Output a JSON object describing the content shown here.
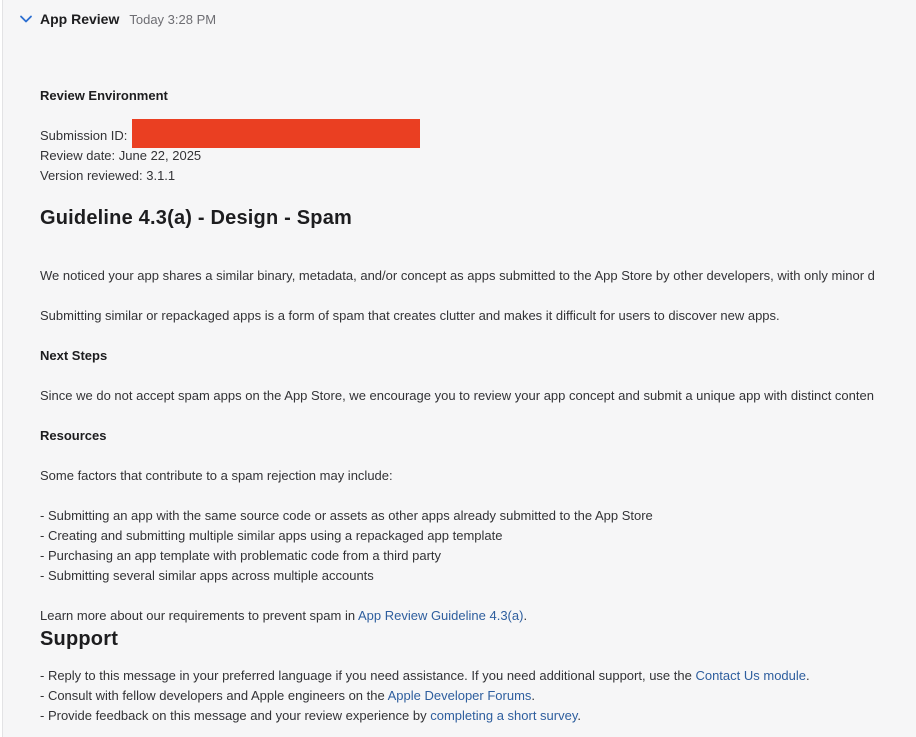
{
  "header": {
    "title": "App Review",
    "time": "Today 3:28 PM",
    "icon": "chevron-down-icon"
  },
  "environment": {
    "heading": "Review Environment",
    "submission_label": "Submission ID:",
    "review_date": "Review date: June 22, 2025",
    "version": "Version reviewed: 3.1.1"
  },
  "guideline": {
    "title": "Guideline 4.3(a) - Design - Spam",
    "para1": "We noticed your app shares a similar binary, metadata, and/or concept as apps submitted to the App Store by other developers, with only minor d",
    "para2": "Submitting similar or repackaged apps is a form of spam that creates clutter and makes it difficult for users to discover new apps.",
    "next_steps_heading": "Next Steps",
    "next_steps_text": "Since we do not accept spam apps on the App Store, we encourage you to review your app concept and submit a unique app with distinct conten",
    "resources_heading": "Resources",
    "resources_intro": "Some factors that contribute to a spam rejection may include:",
    "factors": [
      "- Submitting an app with the same source code or assets as other apps already submitted to the App Store",
      "- Creating and submitting multiple similar apps using a repackaged app template",
      "- Purchasing an app template with problematic code from a third party",
      "- Submitting several similar apps across multiple accounts"
    ],
    "learn_more_prefix": "Learn more about our requirements to prevent spam in ",
    "learn_more_link": "App Review Guideline 4.3(a)",
    "learn_more_suffix": "."
  },
  "support": {
    "title": "Support",
    "item1_prefix": "- Reply to this message in your preferred language if you need assistance. If you need additional support, use the ",
    "item1_link": "Contact Us module",
    "item1_suffix": ".",
    "item2_prefix": "- Consult with fellow developers and Apple engineers on the ",
    "item2_link": "Apple Developer Forums",
    "item2_suffix": ".",
    "item3_prefix": "- Provide feedback on this message and your review experience by ",
    "item3_link": "completing a short survey",
    "item3_suffix": "."
  },
  "colors": {
    "redaction": "#ea3f22",
    "link": "#2e5e9e",
    "background": "#f6f6f7"
  }
}
